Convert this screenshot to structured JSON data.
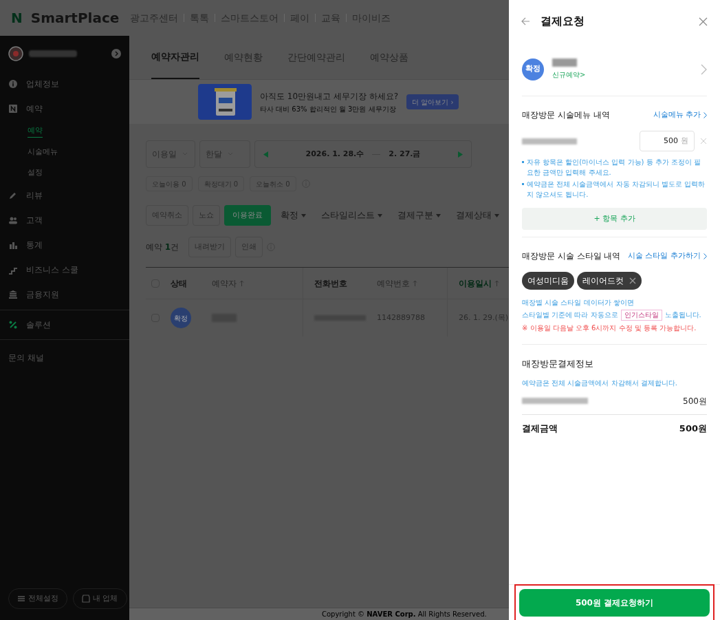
{
  "top_bar": {
    "logo_mark": "N",
    "logo": "SmartPlace",
    "links": [
      "광고주센터",
      "톡톡",
      "스마트스토어",
      "페이",
      "교육",
      "마이비즈"
    ]
  },
  "sidebar": {
    "items": [
      {
        "label": "업체정보",
        "kind": "info",
        "selected": false
      },
      {
        "label": "예약",
        "kind": "booking",
        "selected": false,
        "children": [
          {
            "label": "예약",
            "selected": true
          },
          {
            "label": "시술메뉴",
            "selected": false
          },
          {
            "label": "설정",
            "selected": false
          }
        ]
      },
      {
        "label": "리뷰",
        "kind": "pen",
        "selected": false
      },
      {
        "label": "고객",
        "kind": "people",
        "selected": false
      },
      {
        "label": "통계",
        "kind": "chart",
        "selected": false
      },
      {
        "label": "비즈니스 스쿨",
        "kind": "steps",
        "selected": false
      },
      {
        "label": "금융지원",
        "kind": "bank",
        "selected": false
      },
      {
        "label": "솔루션",
        "kind": "solution",
        "selected": false
      },
      {
        "label": "문의 채널",
        "kind": "plain",
        "selected": false
      }
    ],
    "footer_buttons": [
      "전체설정",
      "내 업체"
    ]
  },
  "tabs": [
    {
      "label": "예약자관리",
      "selected": true
    },
    {
      "label": "예약현황",
      "selected": false
    },
    {
      "label": "간단예약관리",
      "selected": false
    },
    {
      "label": "예약상품",
      "selected": false
    }
  ],
  "banner": {
    "title": "아직도 10만원내고 세무기장 하세요?",
    "subtitle": "타사 대비 63% 합리적인 월 3만원 세무기장",
    "button": "더 알아보기 ›"
  },
  "filters": {
    "date_type": "이용일",
    "period": "한달",
    "date_from": "2026. 1. 28.수",
    "date_to": "2. 27.금"
  },
  "counts": [
    "오늘이용 0",
    "확정대기 0",
    "오늘취소 0"
  ],
  "actions": [
    {
      "label": "예약취소",
      "kind": "button"
    },
    {
      "label": "노쇼",
      "kind": "button"
    },
    {
      "label": "이용완료",
      "kind": "primary"
    },
    {
      "label": "확정",
      "kind": "dropdown"
    },
    {
      "label": "스타일리스트",
      "kind": "dropdown"
    },
    {
      "label": "결제구분",
      "kind": "dropdown"
    },
    {
      "label": "결제상태",
      "kind": "dropdown"
    }
  ],
  "list_header": {
    "label": "예약",
    "count": "1",
    "unit": "건",
    "buttons": [
      "내려받기",
      "인쇄"
    ]
  },
  "table": {
    "select_all": {
      "checked": false
    },
    "columns": [
      {
        "label": "상태",
        "sortable": false,
        "selected": false
      },
      {
        "label": "예약자",
        "sortable": true,
        "selected": false
      },
      {
        "label": "전화번호",
        "sortable": false,
        "selected": false
      },
      {
        "label": "예약번호",
        "sortable": true,
        "selected": false
      },
      {
        "label": "이용일시",
        "sortable": true,
        "selected": true
      }
    ],
    "rows": [
      {
        "checked": false,
        "status": "확정",
        "booking_no": "1142889788",
        "date": "26. 1. 29.(목)"
      }
    ]
  },
  "copyright": "Copyright © **NAVER Corp.** All Rights Reserved.",
  "panel": {
    "title": "결제요청",
    "status": "확정",
    "customer_link": "신규예약>",
    "menu_section": {
      "title": "매장방문 시술메뉴 내역",
      "link": "시술메뉴 추가",
      "price": "500",
      "unit": "원",
      "notes": [
        "자유 항목은 할인(마이너스 입력 가능) 등 추가 조정이 필요한 금액만 입력해 주세요.",
        "예약금은 전체 시술금액에서 자동 차감되니 별도로 입력하지 않으셔도 됩니다."
      ],
      "add_button": "+ 항목 추가"
    },
    "style_section": {
      "title": "매장방문 시술 스타일 내역",
      "link": "시술 스타일 추가하기",
      "chips": [
        {
          "label": "여성미디움",
          "removable": false
        },
        {
          "label": "레이어드컷",
          "removable": true
        }
      ],
      "info_line1": "매장별 시술 스타일 데이터가 쌓이면",
      "info_before": "스타일별 기준에 따라 자동으로",
      "badge": "인기스타일",
      "info_after": "노출됩니다.",
      "warning": "※ 이용일 다음날 오후 6시까지 수정 및 등록 가능합니다."
    },
    "payment_section": {
      "title": "매장방문결제정보",
      "note": "예약금은 전체 시술금액에서 차감해서 결제합니다.",
      "item_amount": "500원",
      "total_label": "결제금액",
      "total": "500원"
    },
    "submit": "500원 결제요청하기"
  }
}
